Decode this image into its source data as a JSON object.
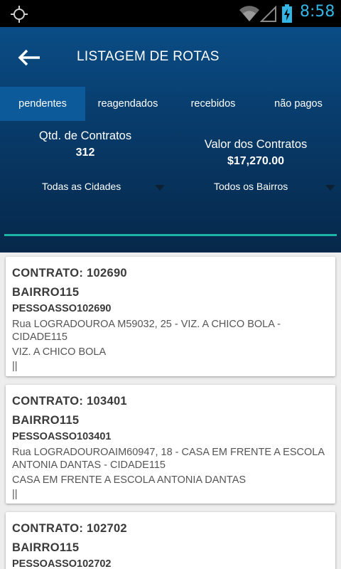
{
  "status_bar": {
    "time": "8:58",
    "icons": [
      "gps-icon",
      "wifi-icon",
      "signal-icon",
      "battery-charging-icon"
    ],
    "accent_color": "#33b5e5"
  },
  "header": {
    "title": "LISTAGEM DE ROTAS",
    "back_icon": "arrow-back-icon"
  },
  "tabs": [
    {
      "label": "pendentes",
      "active": true
    },
    {
      "label": "reagendados",
      "active": false
    },
    {
      "label": "recebidos",
      "active": false
    },
    {
      "label": "não pagos",
      "active": false
    }
  ],
  "summary": {
    "qty_label": "Qtd. de Contratos",
    "qty_value": "312",
    "value_label": "Valor dos Contratos",
    "value_value": "$17,270.00"
  },
  "filters": {
    "city": "Todas as Cidades",
    "bairro": "Todos os Bairros"
  },
  "colors": {
    "header_top": "#0a4d86",
    "header_bottom": "#06284a",
    "active_tab": "#0c5a99",
    "divider": "#1cb3a6",
    "background": "#ededed"
  },
  "contracts": [
    {
      "contract": "CONTRATO: 102690",
      "bairro": "BAIRRO115",
      "pessoa": "PESSOASSO102690",
      "address": "Rua LOGRADOUROA M59032, 25 - VIZ. A CHICO BOLA - CIDADE115",
      "reference": "VIZ. A CHICO BOLA",
      "extra": "||"
    },
    {
      "contract": "CONTRATO: 103401",
      "bairro": "BAIRRO115",
      "pessoa": "PESSOASSO103401",
      "address": "Rua LOGRADOUROAIM60947, 18 - CASA EM FRENTE A ESCOLA ANTONIA DANTAS - CIDADE115",
      "reference": "CASA EM FRENTE A ESCOLA ANTONIA DANTAS",
      "extra": "||"
    },
    {
      "contract": "CONTRATO: 102702",
      "bairro": "BAIRRO115",
      "pessoa": "PESSOASSO102702",
      "address": "",
      "reference": "",
      "extra": ""
    }
  ]
}
